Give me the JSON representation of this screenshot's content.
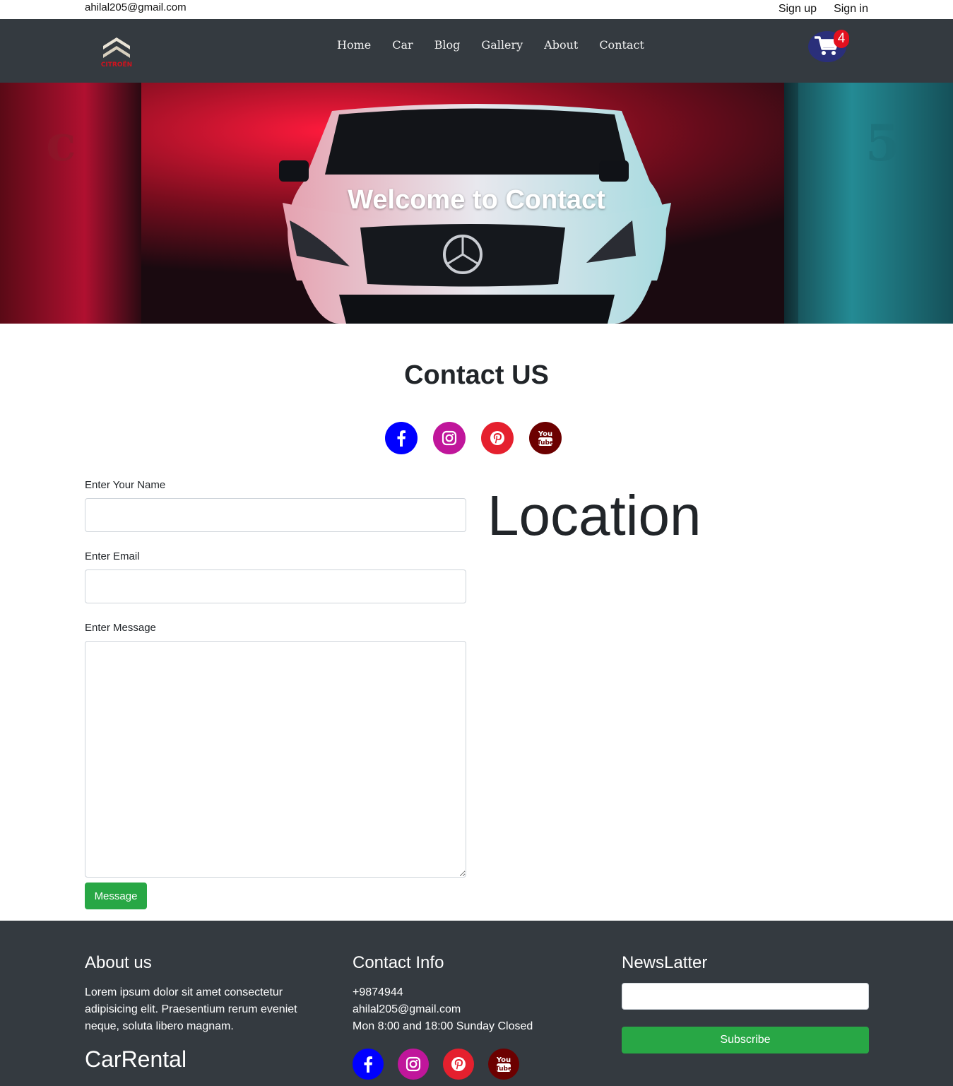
{
  "topbar": {
    "email": "ahilal205@gmail.com",
    "signup_label": "Sign up",
    "signin_label": "Sign in"
  },
  "navbar": {
    "logo_text": "CITROËN",
    "links": [
      "Home",
      "Car",
      "Blog",
      "Gallery",
      "About",
      "Contact"
    ],
    "cart_count": "4"
  },
  "hero": {
    "title": "Welcome to Contact"
  },
  "contact": {
    "title": "Contact US",
    "social_icons": [
      "facebook-icon",
      "instagram-icon",
      "pinterest-icon",
      "youtube-icon"
    ]
  },
  "form": {
    "name_label": "Enter Your Name",
    "name_value": "",
    "email_label": "Enter Email",
    "email_value": "",
    "message_label": "Enter Message",
    "message_value": "",
    "submit_label": "Message"
  },
  "location": {
    "title": "Location"
  },
  "footer": {
    "about": {
      "title": "About us",
      "text": "Lorem ipsum dolor sit amet consectetur adipisicing elit. Praesentium rerum eveniet neque, soluta libero magnam.",
      "brand": "CarRental"
    },
    "contact_info": {
      "title": "Contact Info",
      "phone": "+9874944",
      "email": "ahilal205@gmail.com",
      "hours": "Mon 8:00 and 18:00 Sunday Closed"
    },
    "newsletter": {
      "title": "NewsLatter",
      "input_value": "",
      "button_label": "Subscribe"
    }
  },
  "colors": {
    "navbar_bg": "#343a40",
    "success": "#28a745",
    "facebook": "#0000ff",
    "instagram": "#c0169b",
    "pinterest": "#e5202e",
    "youtube": "#6c0000",
    "cart_badge": "#e3101e"
  }
}
